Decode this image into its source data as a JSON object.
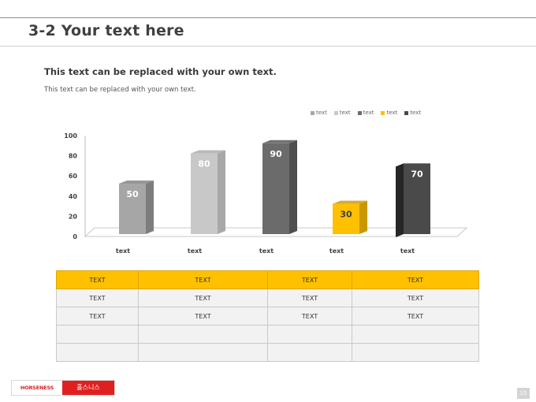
{
  "header": {
    "title": "3-2 Your text here"
  },
  "content": {
    "subtitle": "This text can be replaced with your own text.",
    "body": "This text can be replaced with your own text."
  },
  "chart_data": {
    "type": "bar",
    "categories": [
      "text",
      "text",
      "text",
      "text",
      "text"
    ],
    "values": [
      50,
      80,
      90,
      30,
      70
    ],
    "data_labels": [
      "50",
      "80",
      "90",
      "30",
      "70"
    ],
    "legend": [
      "text",
      "text",
      "text",
      "text",
      "text"
    ],
    "legend_position": "top-right",
    "ylim": [
      0,
      100
    ],
    "y_ticks": [
      0,
      20,
      40,
      60,
      80,
      100
    ],
    "grid": false,
    "three_d": true,
    "colors": [
      "#a6a6a6",
      "#c8c8c8",
      "#6b6b6b",
      "#ffc000",
      "#4a4a4a"
    ],
    "side_colors": [
      "#7d7d7d",
      "#a8a8a8",
      "#4e4e4e",
      "#c99700",
      "#262626"
    ]
  },
  "table": {
    "header": [
      "TEXT",
      "TEXT",
      "TEXT",
      "TEXT"
    ],
    "rows": [
      [
        "TEXT",
        "TEXT",
        "TEXT",
        "TEXT"
      ],
      [
        "TEXT",
        "TEXT",
        "TEXT",
        "TEXT"
      ],
      [
        "",
        "",
        "",
        ""
      ],
      [
        "",
        "",
        "",
        ""
      ]
    ]
  },
  "footer": {
    "brand_en": "HORSENESS",
    "brand_ko": "홀스니스",
    "page_number": "15"
  }
}
